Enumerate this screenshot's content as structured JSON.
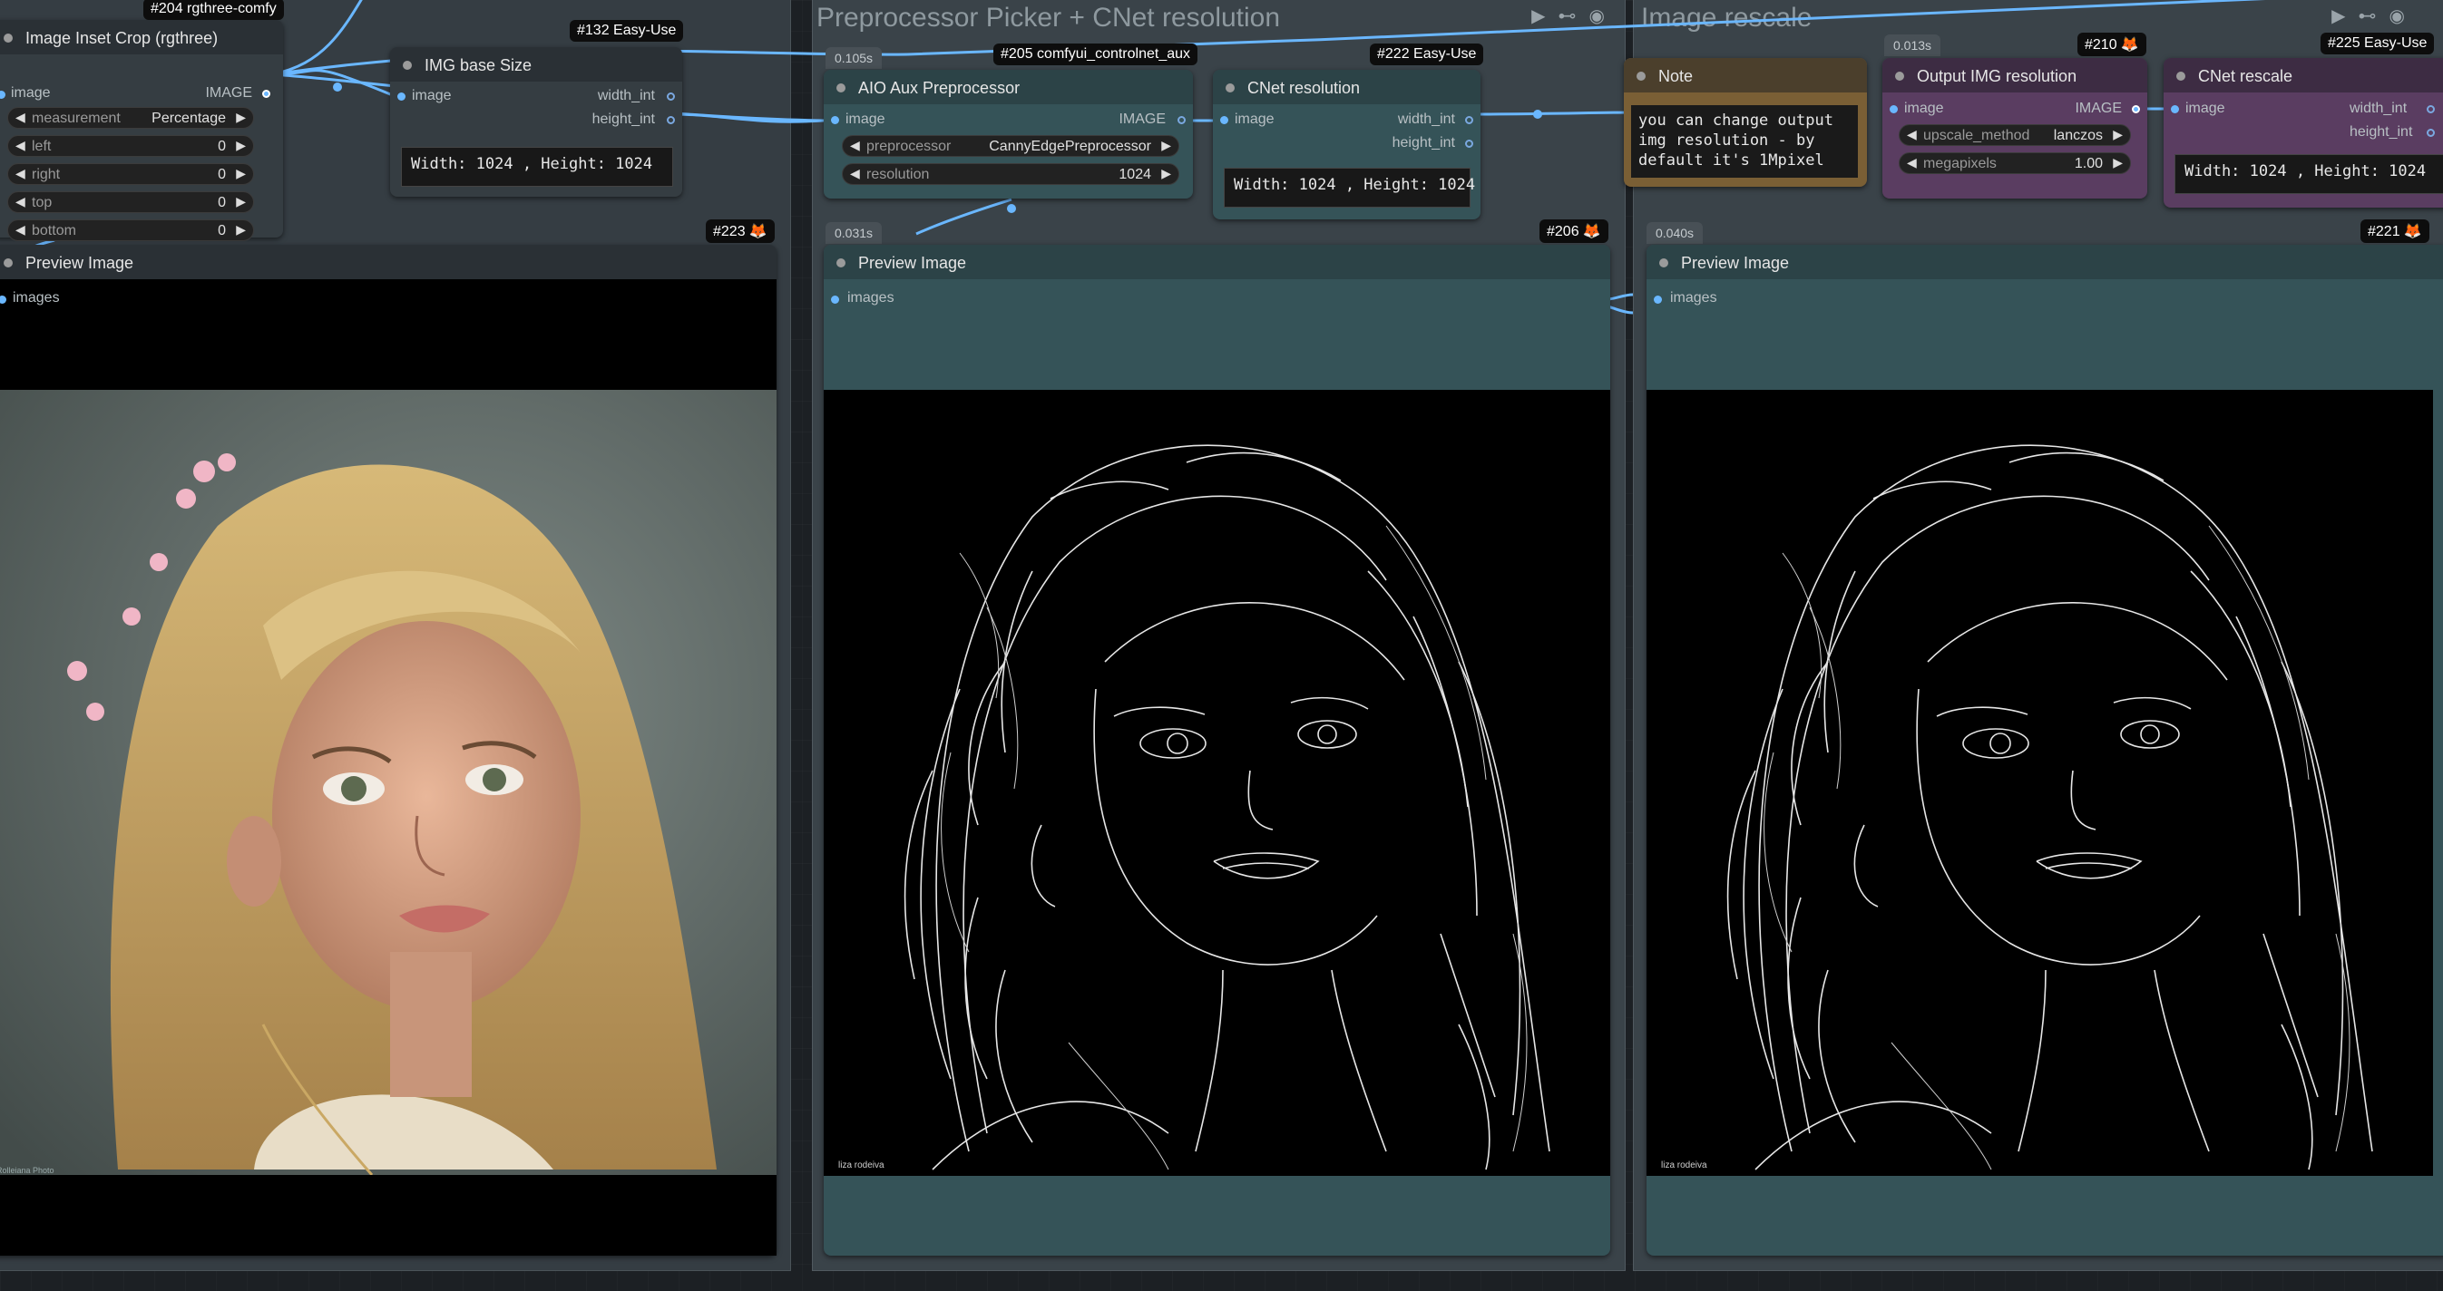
{
  "groups": {
    "middle": {
      "title": "Preprocessor Picker + CNet resolution"
    },
    "right": {
      "title": "Image rescale"
    }
  },
  "nodes": {
    "inset_crop": {
      "title": "Image Inset Crop (rgthree)",
      "badge": "#204 rgthree-comfy",
      "input_label": "image",
      "output_label": "IMAGE",
      "widgets": [
        {
          "label": "measurement",
          "value": "Percentage"
        },
        {
          "label": "left",
          "value": "0"
        },
        {
          "label": "right",
          "value": "0"
        },
        {
          "label": "top",
          "value": "0"
        },
        {
          "label": "bottom",
          "value": "0"
        }
      ]
    },
    "img_base_size": {
      "title": "IMG base Size",
      "badge": "#132 Easy-Use",
      "input_label": "image",
      "outputs": [
        "width_int",
        "height_int"
      ],
      "text": "Width: 1024 , Height: 1024"
    },
    "aio_aux": {
      "title": "AIO Aux Preprocessor",
      "badge": "#205 comfyui_controlnet_aux",
      "time": "0.105s",
      "input_label": "image",
      "output_label": "IMAGE",
      "widgets": [
        {
          "label": "preprocessor",
          "value": "CannyEdgePreprocessor"
        },
        {
          "label": "resolution",
          "value": "1024"
        }
      ]
    },
    "cnet_resolution": {
      "title": "CNet resolution",
      "badge": "#222 Easy-Use",
      "input_label": "image",
      "outputs": [
        "width_int",
        "height_int"
      ],
      "text": "Width: 1024 , Height: 1024"
    },
    "note": {
      "title": "Note",
      "lines": [
        "you can change output",
        "img resolution - by",
        "default it's 1Mpixel"
      ]
    },
    "output_img_res": {
      "title": "Output IMG resolution",
      "badge": "#210",
      "time": "0.013s",
      "input_label": "image",
      "output_label": "IMAGE",
      "widgets": [
        {
          "label": "upscale_method",
          "value": "lanczos"
        },
        {
          "label": "megapixels",
          "value": "1.00"
        }
      ]
    },
    "cnet_rescale": {
      "title": "CNet rescale",
      "badge": "#225 Easy-Use",
      "input_label": "image",
      "outputs": [
        "width_int",
        "height_int"
      ],
      "text": "Width: 1024 , Height: 1024"
    },
    "preview_left": {
      "title": "Preview Image",
      "badge": "#223",
      "input_label": "images",
      "watermark": "Rolleiana Photo"
    },
    "preview_mid": {
      "title": "Preview Image",
      "badge": "#206",
      "time": "0.031s",
      "input_label": "images",
      "signature": "liza rodeiva"
    },
    "preview_right": {
      "title": "Preview Image",
      "badge": "#221",
      "time": "0.040s",
      "input_label": "images",
      "signature": "liza rodeiva"
    }
  },
  "colors": {
    "link": "#6ab7ff",
    "node_body": "#353d42",
    "node_title": "#2a3035",
    "preview_body": "#355358",
    "note_title": "#4b3f2c",
    "note_body": "#7a5f35",
    "purple_title": "#3d2c43",
    "purple_body": "#5a3d61",
    "badge_icon": "#ff8a3c"
  },
  "icons": [
    "play-icon",
    "link-icon",
    "eye-icon",
    "fox-icon",
    "arrow-left-icon",
    "arrow-right-icon"
  ]
}
